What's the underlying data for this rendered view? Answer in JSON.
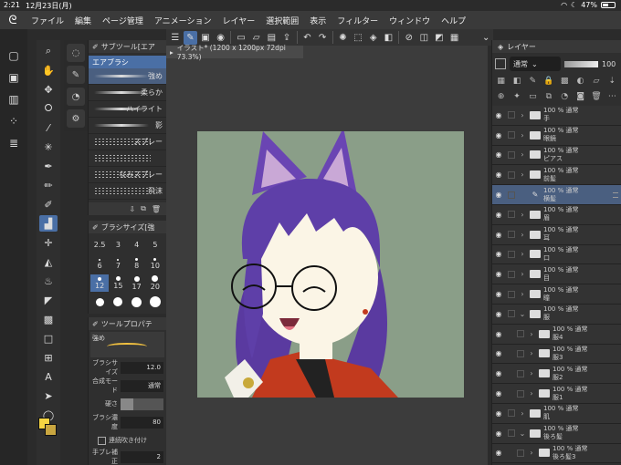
{
  "status": {
    "time": "2:21",
    "date": "12月23日(月)",
    "battery": "47%"
  },
  "menu": [
    "ファイル",
    "編集",
    "ページ管理",
    "アニメーション",
    "レイヤー",
    "選択範囲",
    "表示",
    "フィルター",
    "ウィンドウ",
    "ヘルプ"
  ],
  "subtool": {
    "header": "サブツール[エア",
    "group": "エアブラシ",
    "brushes": [
      "強め",
      "柔らか",
      "ハイライト",
      "影",
      "スプレー",
      "",
      "なみスプレー",
      "飛沫"
    ]
  },
  "brushsize": {
    "header": "ブラシサイズ[強",
    "sizes": [
      {
        "label": "2.5",
        "d": 0
      },
      {
        "label": "3",
        "d": 0
      },
      {
        "label": "4",
        "d": 0
      },
      {
        "label": "5",
        "d": 0
      },
      {
        "label": "6",
        "d": 2
      },
      {
        "label": "7",
        "d": 2
      },
      {
        "label": "8",
        "d": 3
      },
      {
        "label": "10",
        "d": 3
      },
      {
        "label": "12",
        "d": 4
      },
      {
        "label": "15",
        "d": 5
      },
      {
        "label": "17",
        "d": 6
      },
      {
        "label": "20",
        "d": 7
      },
      {
        "label": "",
        "d": 9
      },
      {
        "label": "",
        "d": 10
      },
      {
        "label": "",
        "d": 11
      },
      {
        "label": "",
        "d": 12
      }
    ]
  },
  "toolprop": {
    "header": "ツールプロパテ",
    "preview_name": "強め",
    "brush_size_label": "ブラシサイズ",
    "brush_size_value": "12.0",
    "blend_label": "合成モード",
    "blend_value": "通常",
    "hardness_label": "硬さ",
    "density_label": "ブラシ濃度",
    "density_value": "80",
    "continuous_label": "連続吹き付け",
    "stabilize_label": "手ブレ補正",
    "stabilize_value": "2"
  },
  "document": {
    "tab": "イラスト* (1200 x 1200px 72dpi 73.3%)"
  },
  "layers": {
    "header": "レイヤー",
    "blend": "通常",
    "opacity": "100",
    "items": [
      {
        "opacity": "100 %",
        "mode": "通常",
        "name": "手",
        "type": "folder",
        "indent": false,
        "active": false
      },
      {
        "opacity": "100 %",
        "mode": "通常",
        "name": "眼鏡",
        "type": "folder",
        "indent": false,
        "active": false
      },
      {
        "opacity": "100 %",
        "mode": "通常",
        "name": "ピアス",
        "type": "folder",
        "indent": false,
        "active": false
      },
      {
        "opacity": "100 %",
        "mode": "通常",
        "name": "前髪",
        "type": "folder",
        "indent": false,
        "active": false
      },
      {
        "opacity": "100 %",
        "mode": "通常",
        "name": "横髪",
        "type": "raster",
        "indent": false,
        "active": true
      },
      {
        "opacity": "100 %",
        "mode": "通常",
        "name": "眉",
        "type": "folder",
        "indent": false,
        "active": false
      },
      {
        "opacity": "100 %",
        "mode": "通常",
        "name": "耳",
        "type": "folder",
        "indent": false,
        "active": false
      },
      {
        "opacity": "100 %",
        "mode": "通常",
        "name": "口",
        "type": "folder",
        "indent": false,
        "active": false
      },
      {
        "opacity": "100 %",
        "mode": "通常",
        "name": "目",
        "type": "folder",
        "indent": false,
        "active": false
      },
      {
        "opacity": "100 %",
        "mode": "通常",
        "name": "瞳",
        "type": "folder",
        "indent": false,
        "active": false
      },
      {
        "opacity": "100 %",
        "mode": "通常",
        "name": "服",
        "type": "folder",
        "indent": false,
        "active": false,
        "open": true
      },
      {
        "opacity": "100 %",
        "mode": "通常",
        "name": "服4",
        "type": "folder",
        "indent": true,
        "active": false
      },
      {
        "opacity": "100 %",
        "mode": "通常",
        "name": "服3",
        "type": "folder",
        "indent": true,
        "active": false
      },
      {
        "opacity": "100 %",
        "mode": "通常",
        "name": "服2",
        "type": "folder",
        "indent": true,
        "active": false
      },
      {
        "opacity": "100 %",
        "mode": "通常",
        "name": "服1",
        "type": "folder",
        "indent": true,
        "active": false
      },
      {
        "opacity": "100 %",
        "mode": "通常",
        "name": "肌",
        "type": "folder",
        "indent": false,
        "active": false
      },
      {
        "opacity": "100 %",
        "mode": "通常",
        "name": "後ろ髪",
        "type": "folder",
        "indent": false,
        "active": false,
        "open": true
      },
      {
        "opacity": "100 %",
        "mode": "通常",
        "name": "後ろ髪3",
        "type": "folder",
        "indent": true,
        "active": false
      }
    ]
  },
  "colors": {
    "accent": "#4a6fa5",
    "main_color": "#f5d442",
    "sub_color": "#c9a640",
    "canvas_bg": "#8a9e88"
  }
}
